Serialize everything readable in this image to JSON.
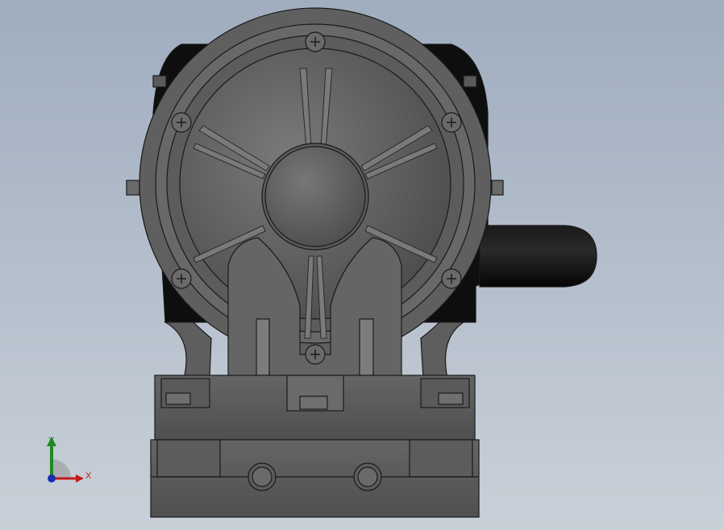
{
  "viewport": {
    "background_top": "#9fadbf",
    "background_bottom": "#c9d0d8"
  },
  "model": {
    "body_color": "#5c5c5c",
    "dark_color": "#0c0c0c",
    "edge_color": "#1a1a1a"
  },
  "triad": {
    "x_label": "X",
    "y_label": "Y",
    "x_color": "#c01a1a",
    "y_color": "#1f8a1f",
    "origin_color": "#1a2fb0"
  }
}
